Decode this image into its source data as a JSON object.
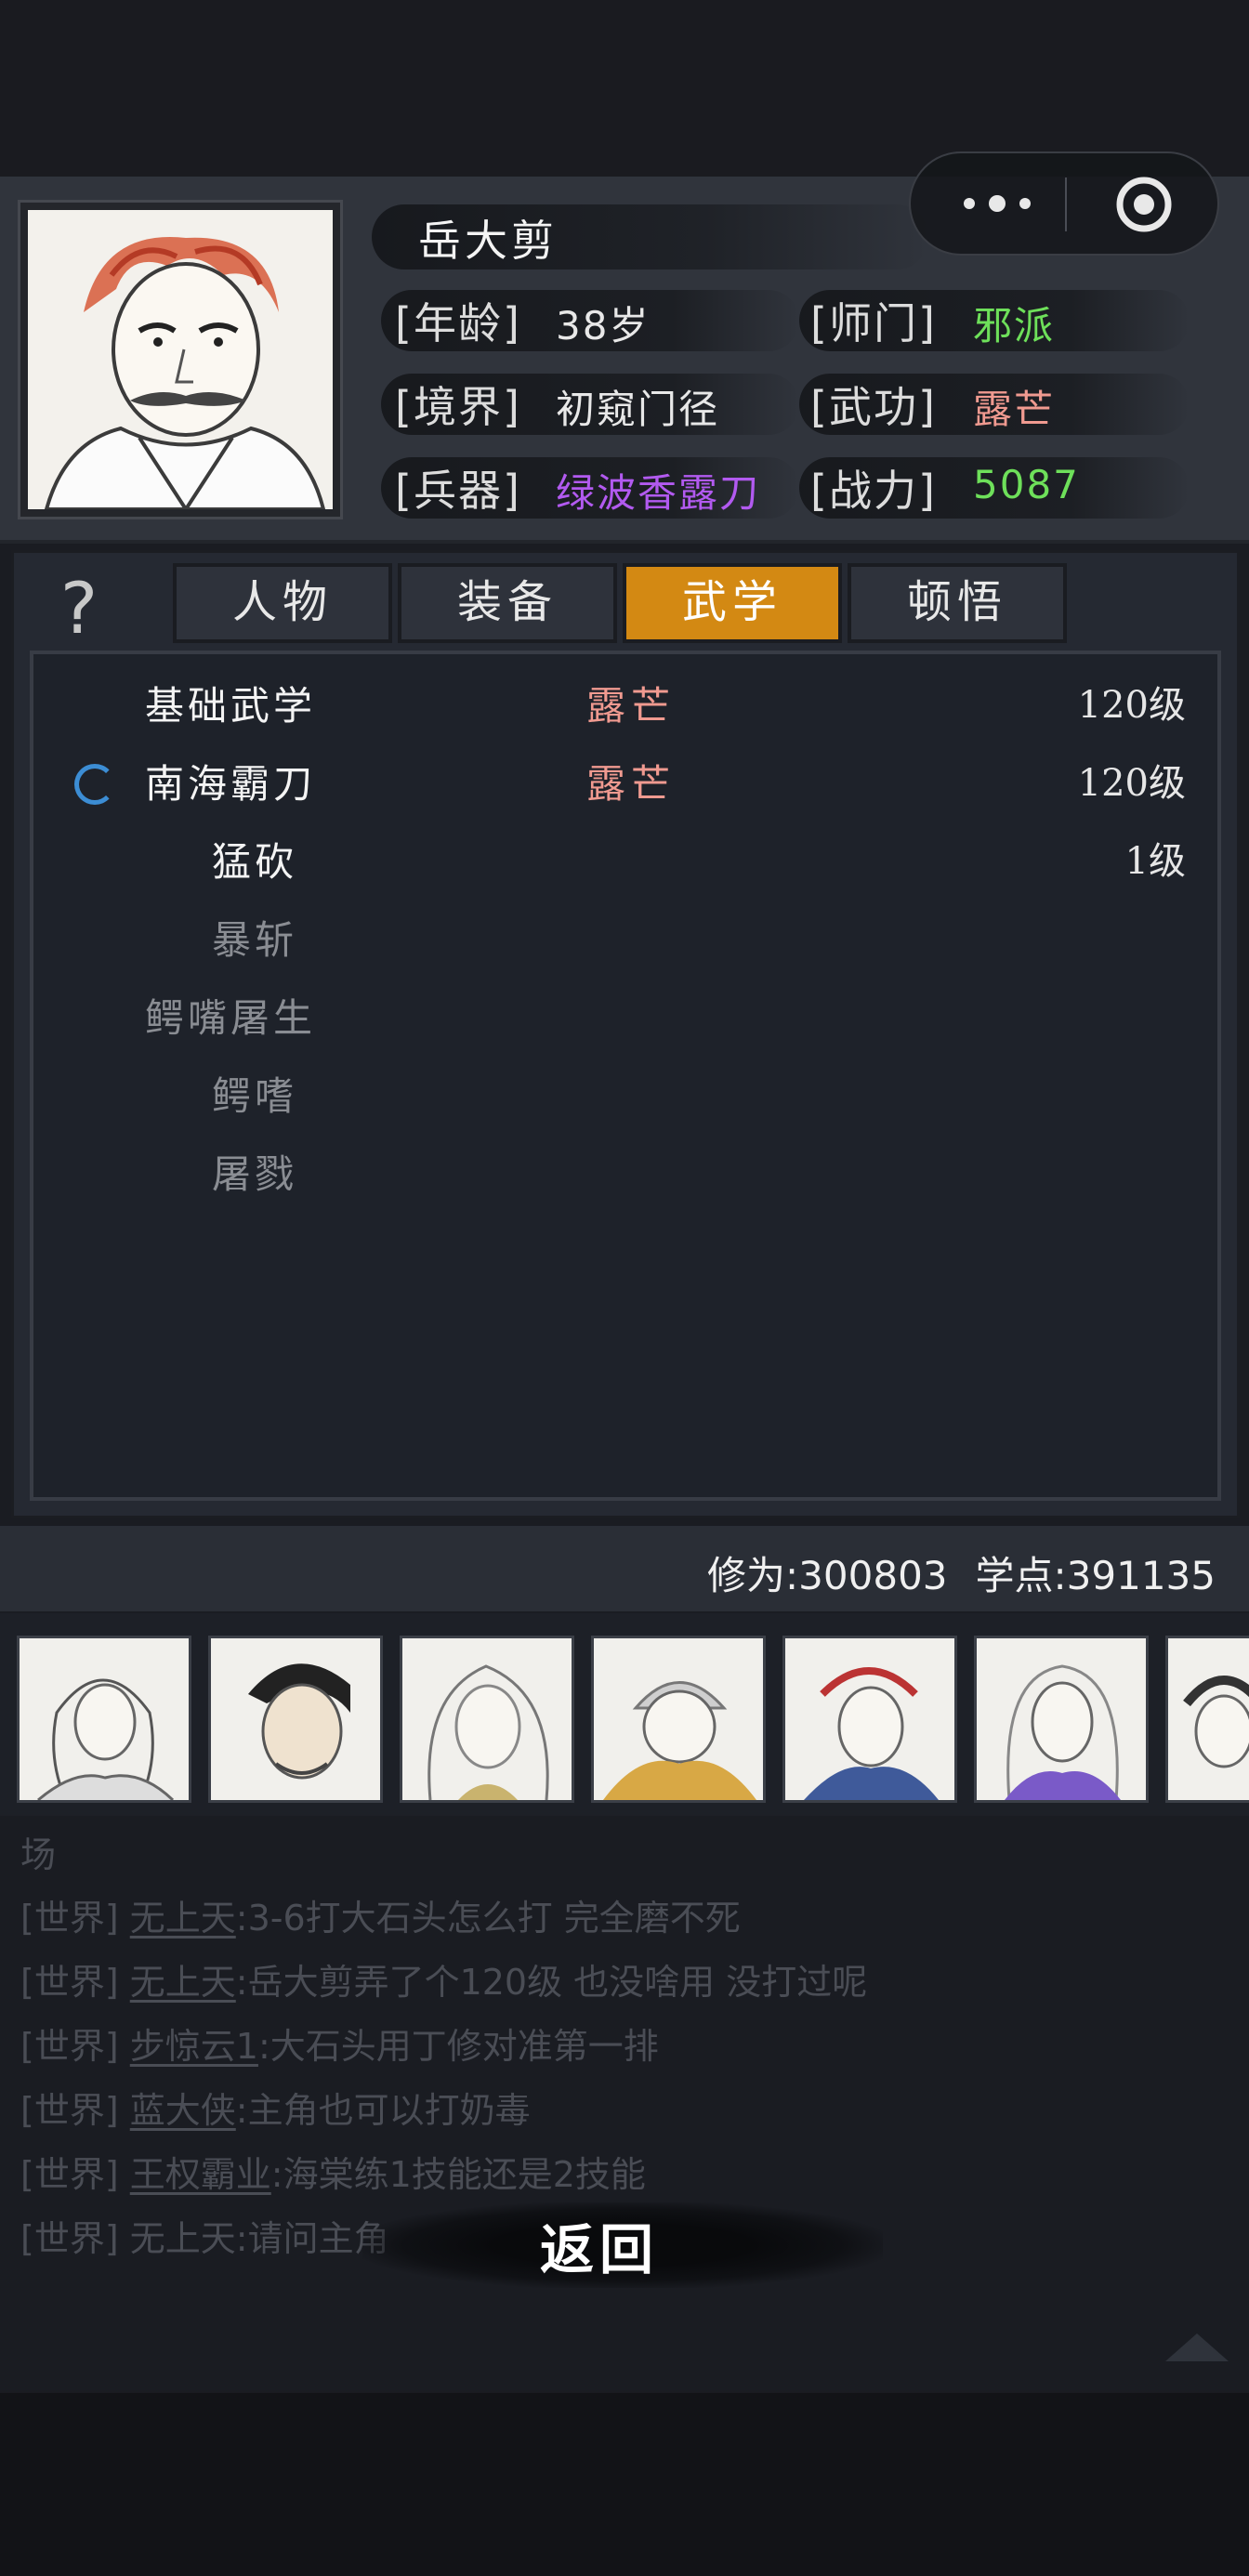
{
  "character": {
    "name": "岳大剪",
    "age_label": "[年龄]",
    "age_value": "38岁",
    "sect_label": "[师门]",
    "sect_value": "邪派",
    "realm_label": "[境界]",
    "realm_value": "初窥门径",
    "martial_label": "[武功]",
    "martial_value": "露芒",
    "weapon_label": "[兵器]",
    "weapon_value": "绿波香露刀",
    "power_label": "[战力]",
    "power_value": "5087"
  },
  "colors": {
    "sect": "#6ee05a",
    "martial": "#f09a90",
    "weapon": "#b25af0",
    "power": "#6ee05a",
    "tab_active": "#d38913"
  },
  "help": {
    "label": "?"
  },
  "tabs": [
    {
      "label": "人物",
      "active": false
    },
    {
      "label": "装备",
      "active": false
    },
    {
      "label": "武学",
      "active": true
    },
    {
      "label": "顿悟",
      "active": false
    }
  ],
  "skills": [
    {
      "name": "基础武学",
      "tag": "露芒",
      "level": "120级",
      "active": true
    },
    {
      "name": "南海霸刀",
      "tag": "露芒",
      "level": "120级",
      "active": true,
      "equipped": true
    },
    {
      "name": "猛砍",
      "tag": "",
      "level": "1级",
      "active": true
    },
    {
      "name": "暴斩",
      "tag": "",
      "level": "",
      "active": false
    },
    {
      "name": "鳄嘴屠生",
      "tag": "",
      "level": "",
      "active": false
    },
    {
      "name": "鳄嗜",
      "tag": "",
      "level": "",
      "active": false
    },
    {
      "name": "屠戮",
      "tag": "",
      "level": "",
      "active": false
    }
  ],
  "stats": {
    "cultivation": "修为:300803",
    "points": "学点:391135"
  },
  "avatars": [
    "hero-1",
    "hero-2",
    "hero-3",
    "hero-4",
    "hero-5",
    "hero-6",
    "hero-7"
  ],
  "chat": {
    "partial_line": "场",
    "messages": [
      {
        "channel": "[世界]",
        "user": "无上天",
        "text": ":3-6打大石头怎么打 完全磨不死"
      },
      {
        "channel": "[世界]",
        "user": "无上天",
        "text": ":岳大剪弄了个120级 也没啥用 没打过呢"
      },
      {
        "channel": "[世界]",
        "user": "步惊云1",
        "text": ":大石头用丁修对准第一排"
      },
      {
        "channel": "[世界]",
        "user": "蓝大侠",
        "text": ":主角也可以打奶毒"
      },
      {
        "channel": "[世界]",
        "user": "王权霸业",
        "text": ":海棠练1技能还是2技能"
      },
      {
        "channel": "[世界]",
        "user": "无上天",
        "text": ":请问主角"
      }
    ]
  },
  "back_button": {
    "label": "返回"
  }
}
